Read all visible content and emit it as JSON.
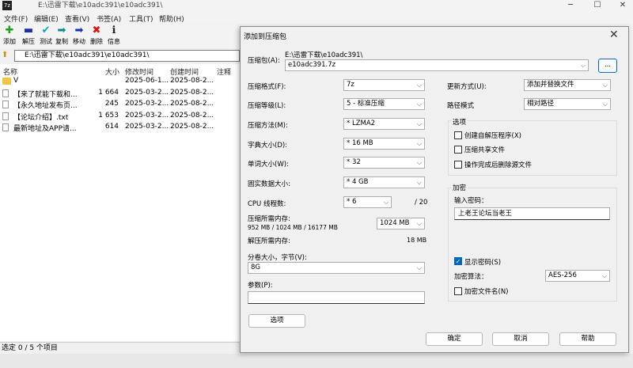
{
  "app": {
    "title": "E:\\迅雷下载\\e10adc391\\e10adc391\\",
    "menu": [
      "文件(F)",
      "编辑(E)",
      "查看(V)",
      "书签(A)",
      "工具(T)",
      "帮助(H)"
    ],
    "toolbar": [
      {
        "label": "添加",
        "icon": "plus-icon",
        "color": "#1aa31a",
        "glyph": "✚"
      },
      {
        "label": "解压",
        "icon": "minus-icon",
        "color": "#1c2fa8",
        "glyph": "▬"
      },
      {
        "label": "测试",
        "icon": "check-icon",
        "color": "#0fa2b8",
        "glyph": "✔"
      },
      {
        "label": "复制",
        "icon": "arrow-right-icon",
        "color": "#0a8c8c",
        "glyph": "➡"
      },
      {
        "label": "移动",
        "icon": "arrow-right-icon",
        "color": "#1c2fa8",
        "glyph": "➡"
      },
      {
        "label": "删除",
        "icon": "x-icon",
        "color": "#d21a1a",
        "glyph": "✖"
      },
      {
        "label": "信息",
        "icon": "info-icon",
        "color": "#222222",
        "glyph": "ℹ"
      }
    ],
    "address": "E:\\迅雷下载\\e10adc391\\e10adc391\\",
    "columns": {
      "name": "名称",
      "size": "大小",
      "modified": "修改时间",
      "created": "创建时间",
      "comment": "注释"
    },
    "rows": [
      {
        "name": "V",
        "size": "",
        "modified": "2025-06-1...",
        "created": "2025-08-2...",
        "folder": true
      },
      {
        "name": "【来了就能下载和...",
        "size": "1 664",
        "modified": "2025-03-2...",
        "created": "2025-08-2...",
        "folder": false
      },
      {
        "name": "【永久地址发布页...",
        "size": "245",
        "modified": "2025-03-2...",
        "created": "2025-08-2...",
        "folder": false
      },
      {
        "name": "【论坛介绍】.txt",
        "size": "1 653",
        "modified": "2025-03-2...",
        "created": "2025-08-2...",
        "folder": false
      },
      {
        "name": "最新地址及APP请...",
        "size": "614",
        "modified": "2025-03-2...",
        "created": "2025-08-2...",
        "folder": false
      }
    ],
    "status": "选定 0 / 5 个项目"
  },
  "dialog": {
    "title": "添加到压缩包",
    "archive_label": "压缩包(A):",
    "archive_path": "E:\\迅雷下载\\e10adc391\\",
    "archive_name": "e10adc391.7z",
    "browse_label": "...",
    "format_label": "压缩格式(F):",
    "format_value": "7z",
    "level_label": "压缩等级(L):",
    "level_value": "5 - 标准压缩",
    "method_label": "压缩方法(M):",
    "method_value": "* LZMA2",
    "dict_label": "字典大小(D):",
    "dict_value": "* 16 MB",
    "word_label": "单词大小(W):",
    "word_value": "* 32",
    "solid_label": "固实数据大小:",
    "solid_value": "* 4 GB",
    "threads_label": "CPU 线程数:",
    "threads_value": "* 6",
    "threads_max": "/ 20",
    "mem_comp_label": "压缩所需内存:",
    "mem_comp_detail": "952 MB / 1024 MB / 16177 MB",
    "mem_comp_value": "1024 MB",
    "mem_decomp_label": "解压所需内存:",
    "mem_decomp_value": "18 MB",
    "volume_label": "分卷大小，字节(V):",
    "volume_value": "8G",
    "params_label": "参数(P):",
    "params_value": "",
    "options_button": "选项",
    "update_label": "更新方式(U):",
    "update_value": "添加并替换文件",
    "path_label": "路径模式",
    "path_value": "相对路径",
    "options_group": "选项",
    "opt_sfx": "创建自解压程序(X)",
    "opt_shared": "压缩共享文件",
    "opt_delete": "操作完成后删除源文件",
    "encrypt_group": "加密",
    "password_label": "输入密码：",
    "password_value": "上老王论坛当老王",
    "show_password": "显示密码(S)",
    "enc_method_label": "加密算法：",
    "enc_method_value": "AES-256",
    "enc_names": "加密文件名(N)",
    "ok": "确定",
    "cancel": "取消",
    "help": "帮助"
  }
}
